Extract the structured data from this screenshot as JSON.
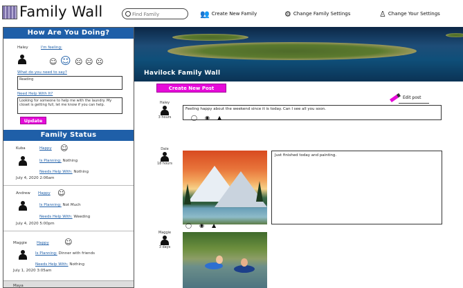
{
  "app": {
    "title": "Family Wall"
  },
  "search": {
    "placeholder": "Find Family"
  },
  "nav": [
    {
      "label": "Create New Family",
      "icon": "people-icon"
    },
    {
      "label": "Change Family Settings",
      "icon": "gears-icon"
    },
    {
      "label": "Change Your Settings",
      "icon": "user-settings-icon"
    }
  ],
  "how_are_you": {
    "header": "How Are You Doing?",
    "user_name": "Haley",
    "feeling_label": "I'm feeling:",
    "what_doing_label": "What do you need to say?",
    "what_doing_value": "Reading",
    "help_label": "Need Help With It?",
    "help_value": "Looking for someone to help me with the laundry. My closet is getting full, let me know if you can help.",
    "update_label": "Update"
  },
  "family_status": {
    "header": "Family Status",
    "entries": [
      {
        "name": "Kuba",
        "mood": "Happy",
        "planning_label": "Is Planning:",
        "planning_value": "Nothing",
        "help_label": "Needs Help With:",
        "help_value": "Nothing",
        "timestamp": "July 4, 2020 2:06am"
      },
      {
        "name": "Andrew",
        "mood": "Happy",
        "planning_label": "Is Planning:",
        "planning_value": "Not Much",
        "help_label": "Needs Help With:",
        "help_value": "Weeding",
        "timestamp": "July 4, 2020 5:00pm"
      },
      {
        "name": "Maggie",
        "mood": "Happy",
        "planning_label": "Is Planning:",
        "planning_value": "Dinner with friends",
        "help_label": "Needs Help With:",
        "help_value": "Nothing",
        "timestamp": "July 1, 2020 3:05am"
      }
    ],
    "footer_name": "Maya"
  },
  "wall": {
    "hero_title": "Havilock Family Wall",
    "create_post_label": "Create New Post",
    "edit_post_label": "Edit post"
  },
  "posts": [
    {
      "author": "Haley",
      "status": "3 hours",
      "text": "Feeling happy about the weekend since it is today. Can I see all you soon."
    },
    {
      "author": "Dale",
      "status": "18 hours",
      "text": "Just finished today and painting."
    },
    {
      "author": "Maggie",
      "status": "3 days"
    }
  ],
  "colors": {
    "accent": "#e60ad9",
    "header_blue": "#1f5fa8"
  }
}
